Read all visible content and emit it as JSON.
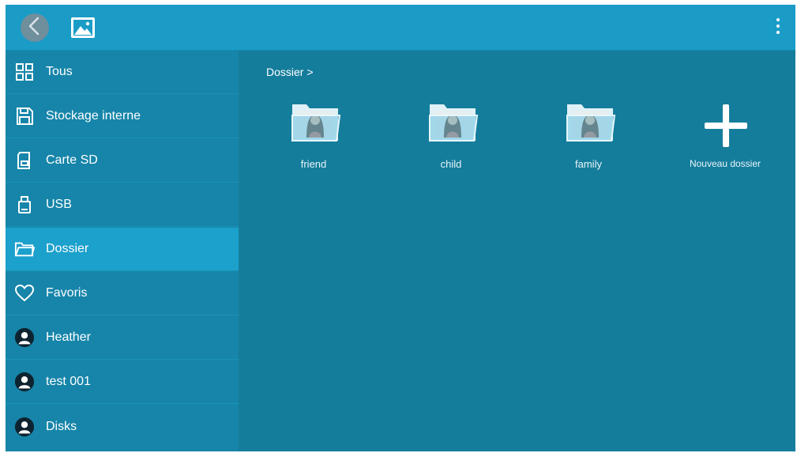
{
  "topbar": {
    "back_icon": "chevron-left-icon",
    "app_icon": "image-gallery-icon",
    "menu_icon": "more-vertical-icon"
  },
  "sidebar": {
    "items": [
      {
        "label": "Tous",
        "icon": "grid-icon"
      },
      {
        "label": "Stockage interne",
        "icon": "save-disk-icon"
      },
      {
        "label": "Carte SD",
        "icon": "sd-card-icon"
      },
      {
        "label": "USB",
        "icon": "usb-icon"
      },
      {
        "label": "Dossier",
        "icon": "folder-icon",
        "selected": true
      },
      {
        "label": "Favoris",
        "icon": "heart-icon"
      },
      {
        "label": "Heather",
        "icon": "person-icon"
      },
      {
        "label": "test 001",
        "icon": "person-icon"
      },
      {
        "label": "Disks",
        "icon": "person-icon"
      }
    ]
  },
  "main": {
    "breadcrumb": "Dossier >",
    "folders": [
      {
        "label": "friend"
      },
      {
        "label": "child"
      },
      {
        "label": "family"
      }
    ],
    "new_folder_label": "Nouveau dossier"
  },
  "colors": {
    "topbar": "#1a9cc7",
    "sidebar": "#1685a9",
    "sidebar_selected": "#1ca0cc",
    "content": "#157d9c"
  }
}
